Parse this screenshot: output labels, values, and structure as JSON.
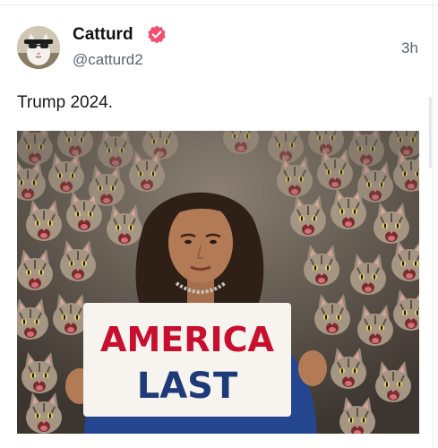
{
  "post": {
    "author_name": "Catturd",
    "author_handle": "@catturd2",
    "timestamp": "3h",
    "text": "Trump 2024.",
    "verified": true
  },
  "image": {
    "sign_line1": "AMERICA",
    "sign_line2": "LAST"
  },
  "icons": {
    "verified": "verified-badge-icon",
    "avatar": "cat-avatar"
  },
  "colors": {
    "verified_badge": "#f0506e",
    "sign_red": "#c8102e",
    "sign_blue": "#1e3a78",
    "handle_gray": "#5b6470"
  }
}
